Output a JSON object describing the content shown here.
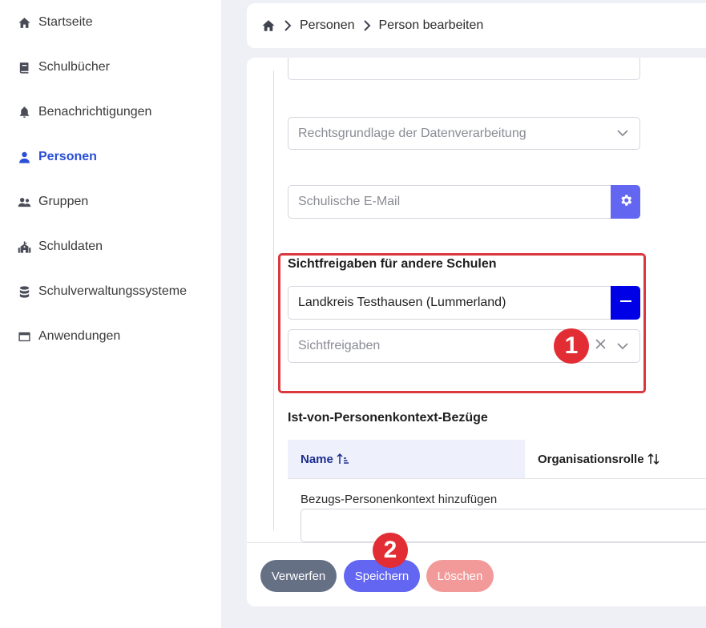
{
  "sidebar": {
    "items": [
      {
        "label": "Startseite",
        "icon": "home-icon"
      },
      {
        "label": "Schulbücher",
        "icon": "book-icon"
      },
      {
        "label": "Benachrichtigungen",
        "icon": "bell-icon"
      },
      {
        "label": "Personen",
        "icon": "person-icon",
        "active": true
      },
      {
        "label": "Gruppen",
        "icon": "users-icon"
      },
      {
        "label": "Schuldaten",
        "icon": "school-icon"
      },
      {
        "label": "Schulverwaltungssysteme",
        "icon": "database-icon"
      },
      {
        "label": "Anwendungen",
        "icon": "window-icon"
      }
    ]
  },
  "breadcrumb": {
    "items": [
      "Personen",
      "Person bearbeiten"
    ]
  },
  "form": {
    "rechtsgrundlage_placeholder": "Rechtsgrundlage der Datenverarbeitung",
    "email_placeholder": "Schulische E-Mail",
    "sichtfreigaben_title": "Sichtfreigaben für andere Schulen",
    "sichtfreigabe_value": "Landkreis Testhausen (Lummerland)",
    "sichtfreigaben_placeholder": "Sichtfreigaben",
    "bezuege_title": "Ist-von-Personenkontext-Bezüge",
    "table": {
      "col_name": "Name",
      "col_role": "Organisationsrolle"
    },
    "add_bezug_label": "Bezugs-Personenkontext hinzufügen"
  },
  "badges": {
    "one": "1",
    "two": "2"
  },
  "actions": {
    "discard": "Verwerfen",
    "save": "Speichern",
    "delete": "Löschen"
  },
  "colors": {
    "accent": "#2a4fd6",
    "primary_button": "#6366f1",
    "remove_button": "#0000e6",
    "highlight": "#d9383e",
    "discard_button": "#667085",
    "delete_button": "#f29a9a"
  }
}
